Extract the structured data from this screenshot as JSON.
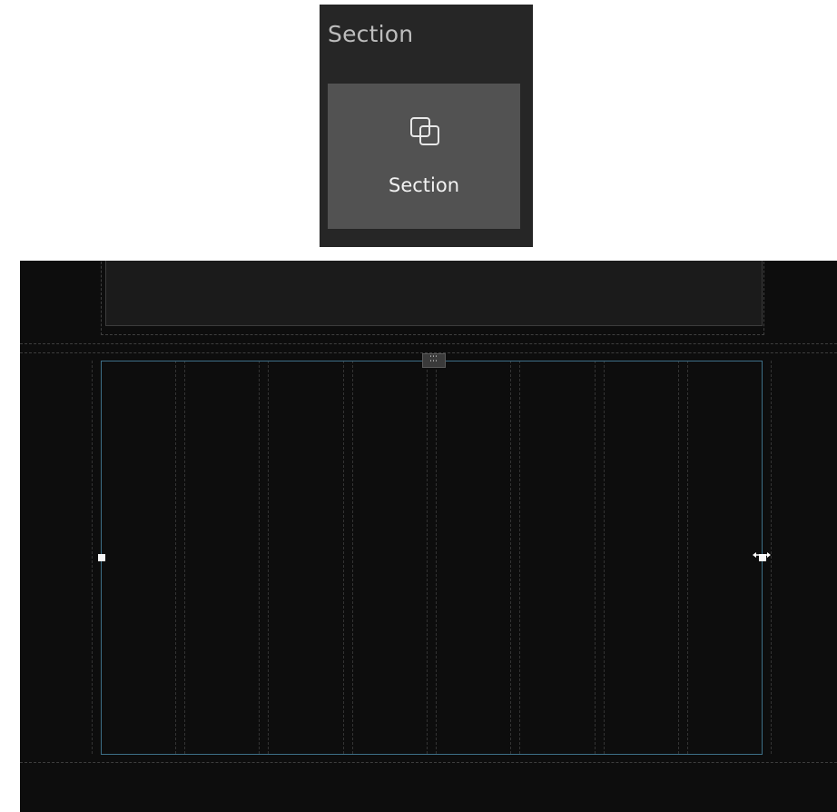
{
  "palette": {
    "title": "Section",
    "tile": {
      "label": "Section",
      "icon": "overlapping-squares-icon"
    }
  },
  "canvas": {
    "background_color": "#0d0d0d",
    "selection_color": "#3d6f87",
    "column_count": 8,
    "drag_handle_glyph": "⋯",
    "icons": [
      "drag-handle-icon",
      "resize-horizontal-icon"
    ]
  }
}
